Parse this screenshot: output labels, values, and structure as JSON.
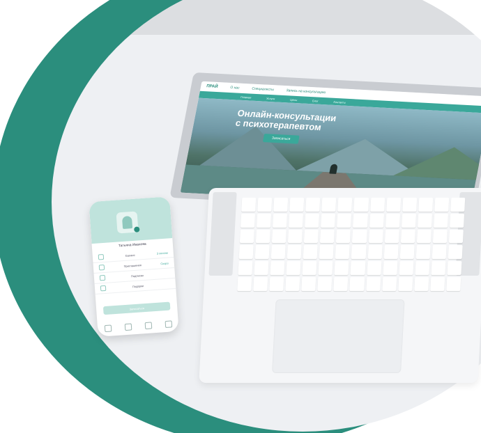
{
  "laptop": {
    "site": {
      "logo": "ПРАЙ",
      "nav": [
        "О нас",
        "Специалисты",
        "Запись на консультацию"
      ],
      "bar": [
        "Главная",
        "Услуги",
        "Цены",
        "Блог",
        "Контакты"
      ],
      "hero_title_line1": "Онлайн-консультации",
      "hero_title_line2": "с психотерапевтом",
      "hero_button": "Записаться"
    }
  },
  "phone": {
    "user_name": "Татьяна Иванова",
    "rows": [
      {
        "label": "Баланс",
        "value": "3 сессии"
      },
      {
        "label": "Приглашения",
        "value": "Скоро"
      },
      {
        "label": "Подписки",
        "value": ""
      },
      {
        "label": "Подарки",
        "value": ""
      }
    ],
    "cta": "Записаться"
  }
}
